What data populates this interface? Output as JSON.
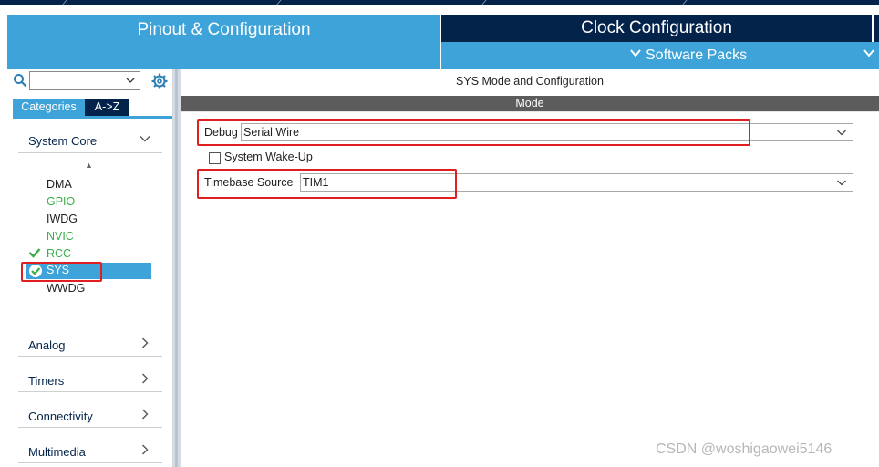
{
  "tabs": {
    "pinout": "Pinout & Configuration",
    "clock": "Clock Configuration",
    "software_packs": "Software Packs"
  },
  "icons": {
    "search": "search-icon",
    "gear": "gear-icon",
    "chevron_down": "chevron-down-icon",
    "chevron_right": "chevron-right-icon",
    "check": "check-icon"
  },
  "sidebar": {
    "search_value": "",
    "view_buttons": {
      "categories": "Categories",
      "az": "A->Z"
    },
    "sections": [
      {
        "label": "System Core",
        "expanded": true
      },
      {
        "label": "Analog",
        "expanded": false
      },
      {
        "label": "Timers",
        "expanded": false
      },
      {
        "label": "Connectivity",
        "expanded": false
      },
      {
        "label": "Multimedia",
        "expanded": false
      }
    ],
    "peripherals": [
      {
        "label": "DMA",
        "status": "none"
      },
      {
        "label": "GPIO",
        "status": "green"
      },
      {
        "label": "IWDG",
        "status": "none"
      },
      {
        "label": "NVIC",
        "status": "green"
      },
      {
        "label": "RCC",
        "status": "configured"
      },
      {
        "label": "SYS",
        "status": "selected"
      },
      {
        "label": "WWDG",
        "status": "none"
      }
    ]
  },
  "main": {
    "title": "SYS Mode and Configuration",
    "mode_header": "Mode",
    "debug": {
      "label": "Debug",
      "value": "Serial Wire"
    },
    "wakeup": {
      "label": "System Wake-Up",
      "checked": false
    },
    "timebase": {
      "label": "Timebase Source",
      "value": "TIM1"
    }
  },
  "watermark": "CSDN @woshigaowei5146",
  "colors": {
    "accent_blue": "#3ea3d9",
    "dark_navy": "#03234b",
    "status_green": "#3cad49",
    "highlight_red": "#e02020"
  }
}
